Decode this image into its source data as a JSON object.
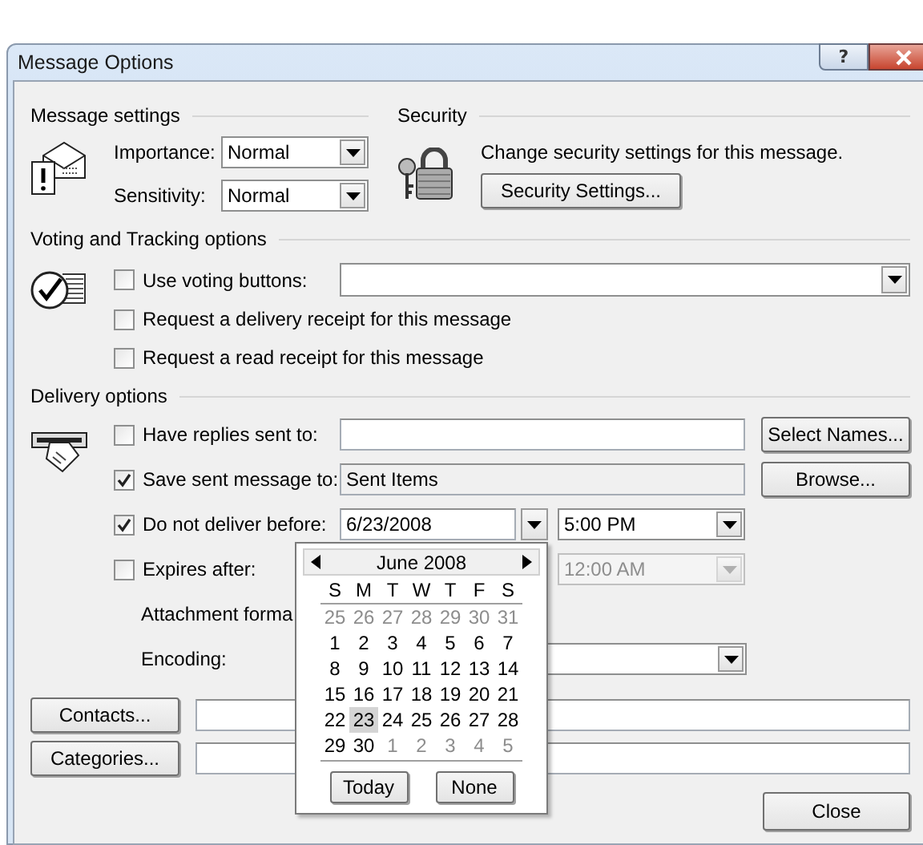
{
  "window": {
    "title": "Message Options",
    "help_button": "?"
  },
  "message_settings": {
    "heading": "Message settings",
    "fields": [
      {
        "label": "Importance:",
        "value": "Normal"
      },
      {
        "label": "Sensitivity:",
        "value": "Normal"
      }
    ]
  },
  "security": {
    "heading": "Security",
    "description": "Change security settings for this message.",
    "button": "Security Settings..."
  },
  "voting": {
    "heading": "Voting and Tracking options",
    "options": [
      {
        "kind": "combo",
        "label": "Use voting buttons:",
        "checked": false
      },
      {
        "kind": "plain",
        "label": "Request a delivery receipt for this message",
        "checked": false
      },
      {
        "kind": "plain",
        "label": "Request a read receipt for this message",
        "checked": false
      }
    ]
  },
  "delivery": {
    "heading": "Delivery options",
    "replies": {
      "label": "Have replies sent to:",
      "checked": false,
      "button": "Select Names..."
    },
    "save_sent": {
      "label": "Save sent message to:",
      "checked": true,
      "value": "Sent Items",
      "button": "Browse..."
    },
    "deliver_before": {
      "label": "Do not deliver before:",
      "checked": true,
      "date": "6/23/2008",
      "time": "5:00 PM"
    },
    "expires": {
      "label": "Expires after:",
      "checked": false,
      "time": "12:00 AM",
      "disabled": true
    },
    "attachment_format": {
      "label": "Attachment forma"
    },
    "encoding": {
      "label": "Encoding:"
    }
  },
  "contacts_button": "Contacts...",
  "categories_button": "Categories...",
  "close_button": "Close",
  "calendar": {
    "month": "June 2008",
    "weekdays": [
      "S",
      "M",
      "T",
      "W",
      "T",
      "F",
      "S"
    ],
    "weeks": [
      [
        {
          "day": "25",
          "other_month": true,
          "selected": false
        },
        {
          "day": "26",
          "other_month": true,
          "selected": false
        },
        {
          "day": "27",
          "other_month": true,
          "selected": false
        },
        {
          "day": "28",
          "other_month": true,
          "selected": false
        },
        {
          "day": "29",
          "other_month": true,
          "selected": false
        },
        {
          "day": "30",
          "other_month": true,
          "selected": false
        },
        {
          "day": "31",
          "other_month": true,
          "selected": false
        }
      ],
      [
        {
          "day": "1",
          "other_month": false,
          "selected": false
        },
        {
          "day": "2",
          "other_month": false,
          "selected": false
        },
        {
          "day": "3",
          "other_month": false,
          "selected": false
        },
        {
          "day": "4",
          "other_month": false,
          "selected": false
        },
        {
          "day": "5",
          "other_month": false,
          "selected": false
        },
        {
          "day": "6",
          "other_month": false,
          "selected": false
        },
        {
          "day": "7",
          "other_month": false,
          "selected": false
        }
      ],
      [
        {
          "day": "8",
          "other_month": false,
          "selected": false
        },
        {
          "day": "9",
          "other_month": false,
          "selected": false
        },
        {
          "day": "10",
          "other_month": false,
          "selected": false
        },
        {
          "day": "11",
          "other_month": false,
          "selected": false
        },
        {
          "day": "12",
          "other_month": false,
          "selected": false
        },
        {
          "day": "13",
          "other_month": false,
          "selected": false
        },
        {
          "day": "14",
          "other_month": false,
          "selected": false
        }
      ],
      [
        {
          "day": "15",
          "other_month": false,
          "selected": false
        },
        {
          "day": "16",
          "other_month": false,
          "selected": false
        },
        {
          "day": "17",
          "other_month": false,
          "selected": false
        },
        {
          "day": "18",
          "other_month": false,
          "selected": false
        },
        {
          "day": "19",
          "other_month": false,
          "selected": false
        },
        {
          "day": "20",
          "other_month": false,
          "selected": false
        },
        {
          "day": "21",
          "other_month": false,
          "selected": false
        }
      ],
      [
        {
          "day": "22",
          "other_month": false,
          "selected": false
        },
        {
          "day": "23",
          "other_month": false,
          "selected": true
        },
        {
          "day": "24",
          "other_month": false,
          "selected": false
        },
        {
          "day": "25",
          "other_month": false,
          "selected": false
        },
        {
          "day": "26",
          "other_month": false,
          "selected": false
        },
        {
          "day": "27",
          "other_month": false,
          "selected": false
        },
        {
          "day": "28",
          "other_month": false,
          "selected": false
        }
      ],
      [
        {
          "day": "29",
          "other_month": false,
          "selected": false
        },
        {
          "day": "30",
          "other_month": false,
          "selected": false
        },
        {
          "day": "1",
          "other_month": true,
          "selected": false
        },
        {
          "day": "2",
          "other_month": true,
          "selected": false
        },
        {
          "day": "3",
          "other_month": true,
          "selected": false
        },
        {
          "day": "4",
          "other_month": true,
          "selected": false
        },
        {
          "day": "5",
          "other_month": true,
          "selected": false
        }
      ]
    ],
    "buttons": [
      "Today",
      "None"
    ]
  }
}
